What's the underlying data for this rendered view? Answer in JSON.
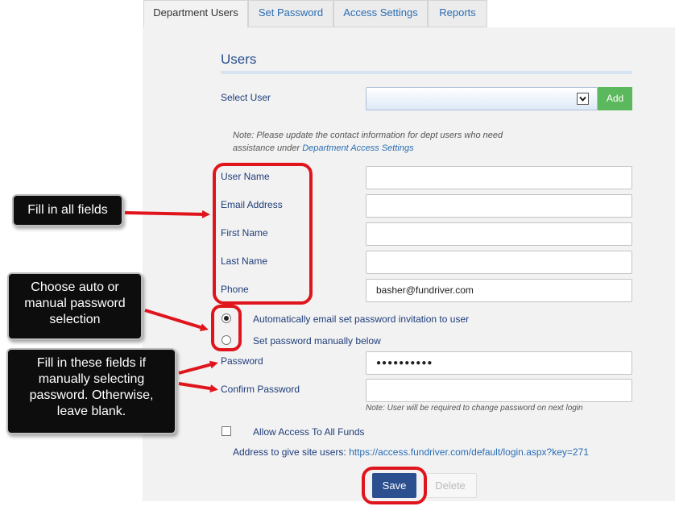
{
  "tabs": [
    {
      "label": "Department Users",
      "active": true
    },
    {
      "label": "Set Password",
      "active": false
    },
    {
      "label": "Access Settings",
      "active": false
    },
    {
      "label": "Reports",
      "active": false
    }
  ],
  "section_title": "Users",
  "select_user": {
    "label": "Select User",
    "value": "",
    "add_label": "Add"
  },
  "note": {
    "text": "Note: Please update the contact information for dept users who need assistance under ",
    "link": "Department Access Settings"
  },
  "fields": {
    "user_name": {
      "label": "User Name",
      "value": ""
    },
    "email": {
      "label": "Email Address",
      "value": ""
    },
    "first_name": {
      "label": "First Name",
      "value": ""
    },
    "last_name": {
      "label": "Last Name",
      "value": ""
    },
    "phone": {
      "label": "Phone",
      "value": "basher@fundriver.com"
    }
  },
  "password_options": {
    "auto": "Automatically email set password invitation to user",
    "manual": "Set password manually below",
    "selected": "auto"
  },
  "password": {
    "label": "Password",
    "value": "●●●●●●●●●●"
  },
  "confirm_password": {
    "label": "Confirm Password",
    "value": ""
  },
  "password_note": "Note: User will be required to change password on next login",
  "allow_all_funds": {
    "label": "Allow Access To All Funds",
    "checked": false
  },
  "site_address": {
    "label": "Address to give site users:",
    "url": "https://access.fundriver.com/default/login.aspx?key=271"
  },
  "buttons": {
    "save": "Save",
    "delete": "Delete"
  },
  "callouts": {
    "fill_all": "Fill in all fields",
    "choose": "Choose auto or manual password selection",
    "fill_manual": "Fill in these fields if manually selecting password.  Otherwise, leave blank."
  },
  "colors": {
    "accent": "#2a6db5",
    "add_button": "#5cb85c",
    "save_button": "#2b4f8f",
    "annotation": "#e0141c",
    "callout_bg": "#0d0d0d"
  },
  "icons": {
    "dropdown": "chevron-down-icon",
    "arrow": "red-arrow-icon"
  }
}
